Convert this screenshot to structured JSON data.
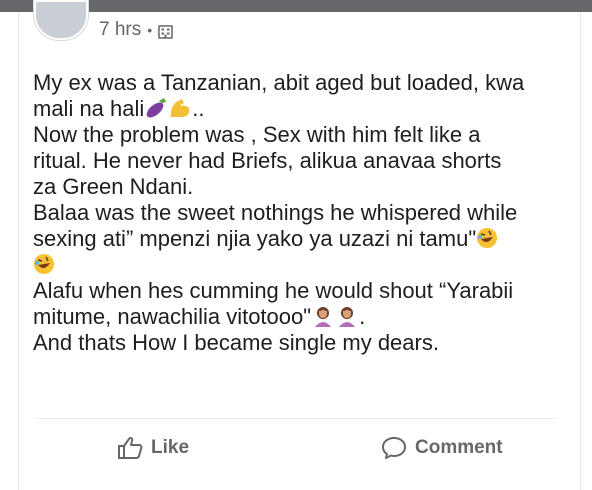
{
  "post": {
    "time": "7 hrs",
    "privacy_icon": "building-icon",
    "lines": [
      "My ex was a Tanzanian, abit aged but loaded, kwa",
      "mali na hali",
      "..",
      "Now the problem was , Sex with him felt like a",
      "ritual. He never had Briefs, alikua anavaa shorts",
      "za Green Ndani.",
      "Balaa was the sweet nothings he whispered while",
      "sexing ati” mpenzi njia yako ya uzazi ni tamu\"",
      "Alafu when hes cumming he would shout “Yarabii",
      "mitume, nawachilia vitotooo\"",
      ".",
      "And thats How I became single my dears."
    ]
  },
  "actions": {
    "like_label": "Like",
    "comment_label": "Comment"
  },
  "colors": {
    "secondary_text": "#65676b",
    "top_bar": "#65676b"
  }
}
